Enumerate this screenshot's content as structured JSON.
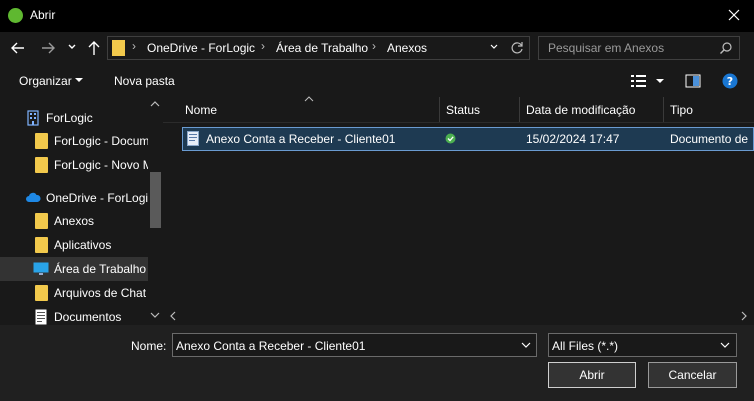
{
  "window": {
    "title": "Abrir"
  },
  "address": {
    "crumbs": [
      "OneDrive - ForLogic",
      "Área de Trabalho",
      "Anexos"
    ],
    "search_placeholder": "Pesquisar em Anexos"
  },
  "toolbar": {
    "organize_label": "Organizar",
    "new_folder_label": "Nova pasta"
  },
  "sidebar": {
    "items": [
      {
        "label": "ForLogic",
        "icon": "building-icon"
      },
      {
        "label": "ForLogic - Docum",
        "icon": "folder-icon"
      },
      {
        "label": "ForLogic - Novo M",
        "icon": "folder-icon"
      },
      {
        "label": "OneDrive - ForLogic",
        "icon": "cloud-icon"
      },
      {
        "label": "Anexos",
        "icon": "folder-icon"
      },
      {
        "label": "Aplicativos",
        "icon": "folder-icon"
      },
      {
        "label": "Área de Trabalho",
        "icon": "desktop-icon",
        "selected": true
      },
      {
        "label": "Arquivos de Chat",
        "icon": "folder-icon"
      },
      {
        "label": "Documentos",
        "icon": "document-icon"
      }
    ]
  },
  "columns": [
    "Nome",
    "Status",
    "Data de modificação",
    "Tipo"
  ],
  "files": [
    {
      "name": "Anexo Conta a Receber - Cliente01",
      "status": "synced",
      "date": "15/02/2024 17:47",
      "type": "Documento de"
    }
  ],
  "footer": {
    "name_label": "Nome:",
    "name_value": "Anexo Conta a Receber - Cliente01",
    "filter_value": "All Files (*.*)",
    "open_label": "Abrir",
    "cancel_label": "Cancelar"
  },
  "colors": {
    "accent": "#1e3a52",
    "selection_border": "#6a9bd1",
    "folder": "#f2c94c",
    "sync_ok": "#4caf50",
    "help": "#1976d2"
  }
}
